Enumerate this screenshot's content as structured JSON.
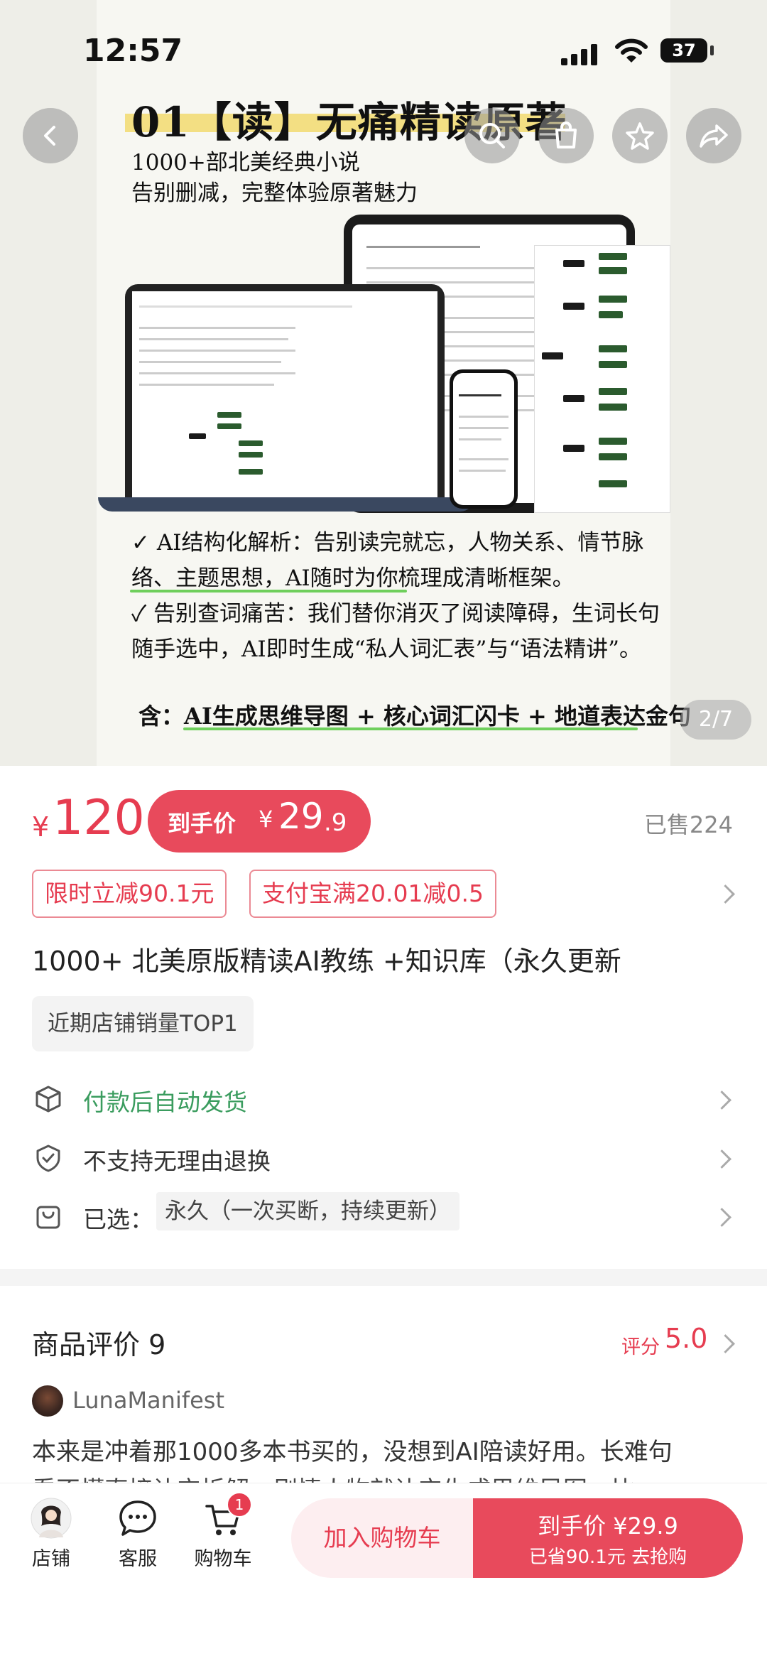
{
  "status_bar": {
    "time": "12:57",
    "battery": "37"
  },
  "hero": {
    "poster_title": "01【读】无痛精读原著",
    "poster_subtitle_1": "1000+部北美经典小说",
    "poster_subtitle_2": "告别删减，完整体验原著魅力",
    "poster_body": [
      "✓ AI结构化解析：告别读完就忘，人物关系、情节脉",
      "络、主题思想，AI随时为你梳理成清晰框架。",
      "✓ 告别查词痛苦：我们替你消灭了阅读障碍，生词长句",
      "随手选中，AI即时生成“私人词汇表”与“语法精讲”。"
    ],
    "poster_footer": "含：AI生成思维导图 + 核心词汇闪卡 + 地道表达金句",
    "page_indicator": "2/7"
  },
  "price": {
    "currency": "¥",
    "amount": "120",
    "deal_label": "到手价",
    "deal_currency": "¥",
    "deal_int": "29",
    "deal_dec": ".9",
    "sold": "已售224"
  },
  "coupons": [
    "限时立减90.1元",
    "支付宝满20.01减0.5"
  ],
  "product_title": "1000+ 北美原版精读AI教练 +知识库（永久更新",
  "rank_tag": "近期店铺销量TOP1",
  "services": [
    {
      "text": "付款后自动发货",
      "icon": "box-icon"
    },
    {
      "text": "不支持无理由退换",
      "icon": "shield-check-icon"
    },
    {
      "text": "已选：",
      "value": "永久（一次买断，持续更新）",
      "icon": "bag-icon"
    }
  ],
  "reviews": {
    "title": "商品评价 9",
    "score_label": "评分",
    "score": "5.0",
    "user": "LunaManifest",
    "text": "本来是冲着那1000多本书买的，没想到AI陪读好用。长难句",
    "text_2": "看不懂直接让它拆解，剧情人物就让它生成思维导图，比"
  },
  "bottom_bar": {
    "shop": "店铺",
    "service": "客服",
    "cart": "购物车",
    "cart_count": "1",
    "add_to_cart": "加入购物车",
    "buy_line1": "到手价 ¥29.9",
    "buy_line2": "已省90.1元 去抢购"
  },
  "colors": {
    "accent": "#e63c50",
    "green": "#3a9c5e",
    "poster_highlight": "#f3df83"
  }
}
